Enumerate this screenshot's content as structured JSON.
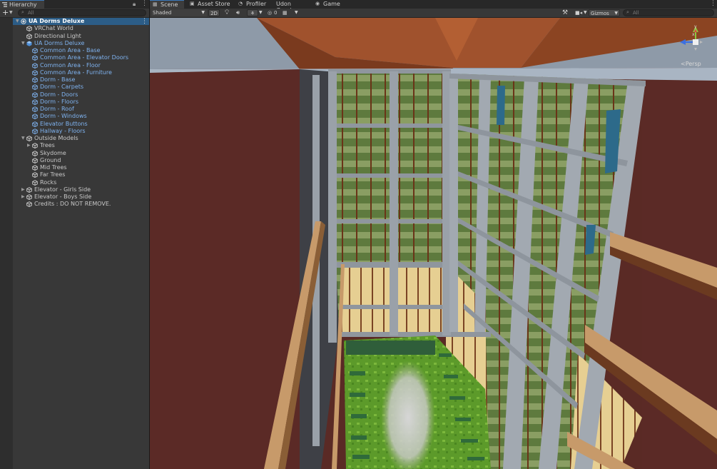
{
  "hierarchy": {
    "tab_label": "Hierarchy",
    "search_placeholder": "All",
    "add_label": "+",
    "rows": [
      {
        "label": "UA Dorms Deluxe",
        "style": "bold",
        "indent": 0,
        "fold": "open",
        "selected": true
      },
      {
        "label": "VRChat World",
        "style": "norm",
        "indent": 1,
        "fold": "none"
      },
      {
        "label": "Directional Light",
        "style": "norm",
        "indent": 1,
        "fold": "none"
      },
      {
        "label": "UA Dorms Deluxe",
        "style": "prefab",
        "indent": 1,
        "fold": "open"
      },
      {
        "label": "Common Area - Base",
        "style": "prefab",
        "indent": 2,
        "fold": "none"
      },
      {
        "label": "Common Area - Elevator Doors",
        "style": "prefab",
        "indent": 2,
        "fold": "none"
      },
      {
        "label": "Common Area - Floor",
        "style": "prefab",
        "indent": 2,
        "fold": "none"
      },
      {
        "label": "Common Area - Furniture",
        "style": "prefab",
        "indent": 2,
        "fold": "none"
      },
      {
        "label": "Dorm - Base",
        "style": "prefab",
        "indent": 2,
        "fold": "none"
      },
      {
        "label": "Dorm - Carpets",
        "style": "prefab",
        "indent": 2,
        "fold": "none"
      },
      {
        "label": "Dorm - Doors",
        "style": "prefab",
        "indent": 2,
        "fold": "none"
      },
      {
        "label": "Dorm - Floors",
        "style": "prefab",
        "indent": 2,
        "fold": "none"
      },
      {
        "label": "Dorm - Roof",
        "style": "prefab",
        "indent": 2,
        "fold": "none"
      },
      {
        "label": "Dorm - Windows",
        "style": "prefab",
        "indent": 2,
        "fold": "none"
      },
      {
        "label": "Elevator Buttons",
        "style": "prefab",
        "indent": 2,
        "fold": "none"
      },
      {
        "label": "Hallway - Floors",
        "style": "prefab",
        "indent": 2,
        "fold": "none"
      },
      {
        "label": "Outside Models",
        "style": "norm",
        "indent": 1,
        "fold": "open"
      },
      {
        "label": "Trees",
        "style": "norm",
        "indent": 2,
        "fold": "closed"
      },
      {
        "label": "Skydome",
        "style": "norm",
        "indent": 2,
        "fold": "none"
      },
      {
        "label": "Ground",
        "style": "norm",
        "indent": 2,
        "fold": "none"
      },
      {
        "label": "Mid Trees",
        "style": "norm",
        "indent": 2,
        "fold": "none"
      },
      {
        "label": "Far Trees",
        "style": "norm",
        "indent": 2,
        "fold": "none"
      },
      {
        "label": "Rocks",
        "style": "norm",
        "indent": 2,
        "fold": "none"
      },
      {
        "label": "Elevator - Girls Side",
        "style": "norm",
        "indent": 1,
        "fold": "closed"
      },
      {
        "label": "Elevator - Boys Side",
        "style": "norm",
        "indent": 1,
        "fold": "closed"
      },
      {
        "label": "Credits : DO NOT REMOVE.",
        "style": "norm",
        "indent": 1,
        "fold": "none"
      }
    ]
  },
  "scene": {
    "tabs": [
      {
        "label": "Scene",
        "icon": "scene-icon",
        "active": true
      },
      {
        "label": "Asset Store",
        "icon": "store-icon",
        "active": false
      },
      {
        "label": "Profiler",
        "icon": "profiler-icon",
        "active": false
      },
      {
        "label": "Udon Graph",
        "icon": "",
        "active": false
      },
      {
        "label": "Game",
        "icon": "game-icon",
        "active": false
      }
    ],
    "toolbar": {
      "shading_mode": "Shaded",
      "two_d_label": "2D",
      "hidden_count": "0",
      "gizmos_label": "Gizmos",
      "search_placeholder": "All"
    },
    "gizmo": {
      "projection_label": "Persp",
      "axis_y": "y",
      "axis_x": "x"
    }
  },
  "colors": {
    "accent": "#3a79bb",
    "selection": "#2c5d87",
    "prefab_text": "#7fb3f0"
  }
}
